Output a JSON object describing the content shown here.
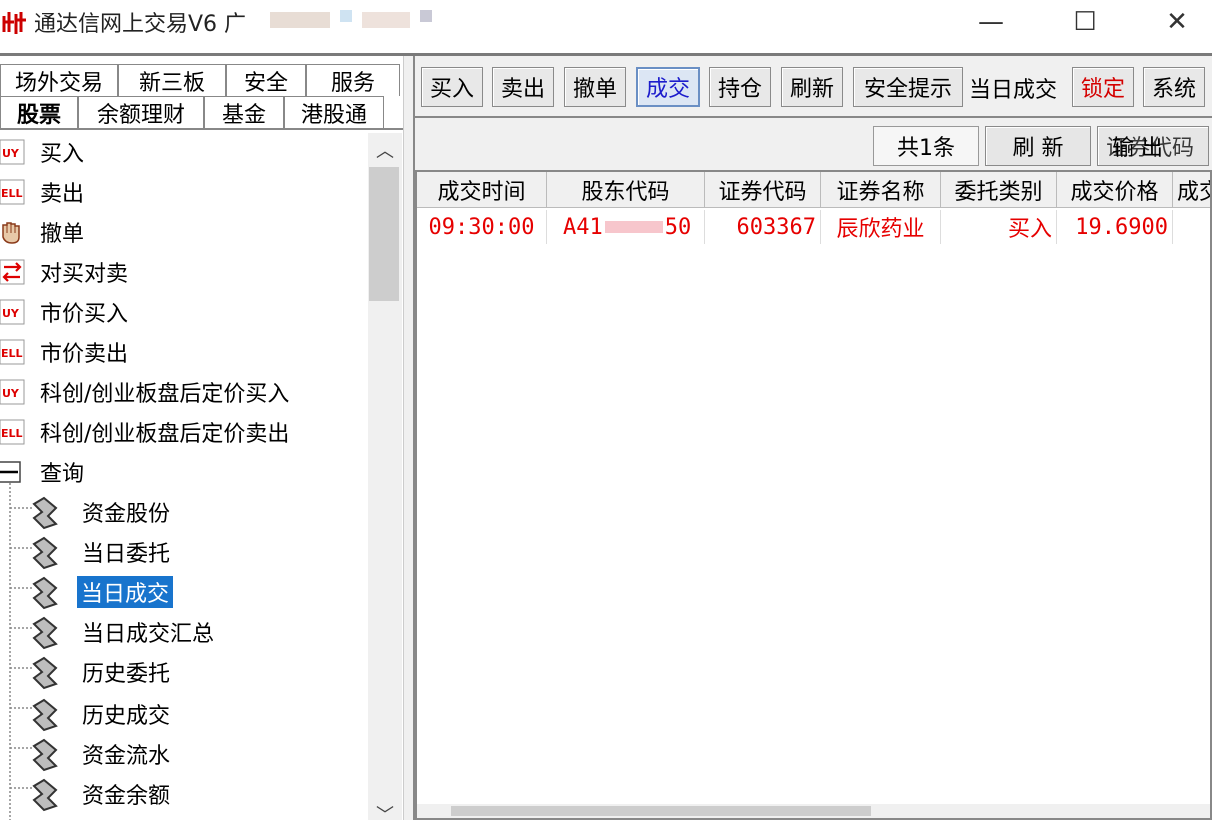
{
  "window": {
    "title": "通达信网上交易V6 广",
    "minimize": "—",
    "maximize": "☐",
    "close": "✕"
  },
  "left_tabs": {
    "row1": [
      "场外交易",
      "新三板",
      "安全",
      "服务"
    ],
    "row2": [
      "股票",
      "余额理财",
      "基金",
      "港股通"
    ],
    "active": "股票"
  },
  "tree": {
    "items": [
      {
        "label": "买入",
        "icon": "buy-icon"
      },
      {
        "label": "卖出",
        "icon": "sell-icon"
      },
      {
        "label": "撤单",
        "icon": "cancel-hand-icon"
      },
      {
        "label": "对买对卖",
        "icon": "swap-icon"
      },
      {
        "label": "市价买入",
        "icon": "buy-icon"
      },
      {
        "label": "市价卖出",
        "icon": "sell-icon"
      },
      {
        "label": "科创/创业板盘后定价买入",
        "icon": "buy-icon"
      },
      {
        "label": "科创/创业板盘后定价卖出",
        "icon": "sell-icon"
      },
      {
        "label": "查询",
        "icon": "collapse-icon"
      }
    ],
    "sub_items": [
      {
        "label": "资金股份"
      },
      {
        "label": "当日委托"
      },
      {
        "label": "当日成交",
        "selected": true
      },
      {
        "label": "当日成交汇总"
      },
      {
        "label": "历史委托"
      },
      {
        "label": "历史成交"
      },
      {
        "label": "资金流水"
      },
      {
        "label": "资金余额"
      }
    ]
  },
  "toolbar": {
    "buy": "买入",
    "sell": "卖出",
    "cancel": "撤单",
    "deal": "成交",
    "position": "持仓",
    "refresh": "刷新",
    "safety_tip": "安全提示",
    "current_view": "当日成交",
    "lock": "锁定",
    "system": "系统"
  },
  "sub_toolbar": {
    "count": "共1条",
    "refresh": "刷 新",
    "output": "输 出",
    "output_overlap": "证券代码"
  },
  "grid": {
    "columns": [
      "成交时间",
      "股东代码",
      "证券代码",
      "证券名称",
      "委托类别",
      "成交价格",
      "成交"
    ],
    "rows": [
      {
        "time": "09:30:00",
        "holder_code": "A41",
        "holder_code_tail": "50",
        "stock_code": "603367",
        "stock_name": "辰欣药业",
        "type": "买入",
        "price": "19.6900"
      }
    ]
  },
  "colors": {
    "accent_blue": "#1874cd",
    "deal_red": "#e60000",
    "lock_red": "#d40000",
    "active_text": "#1c1ccc"
  }
}
